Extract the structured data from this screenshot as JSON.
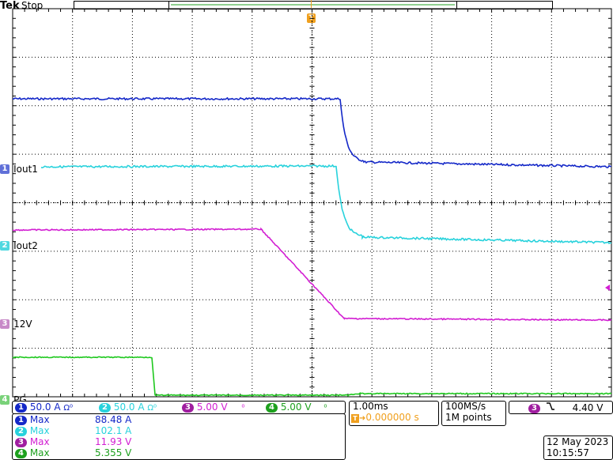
{
  "header": {
    "brand": "Tek",
    "status": "Stop",
    "trigger_marker": "T"
  },
  "colors": {
    "ch1": "#1428c8",
    "ch2": "#28d2dc",
    "ch3": "#d21ed2",
    "ch4": "#1ec81e",
    "trigger": "#f0a01e",
    "grid": "#000000"
  },
  "channel_markers": [
    {
      "num": "1",
      "label": "Iout1"
    },
    {
      "num": "2",
      "label": "Iout2"
    },
    {
      "num": "3",
      "label": "12V"
    },
    {
      "num": "4",
      "label": "PG"
    }
  ],
  "channel_settings": [
    {
      "num": "1",
      "scale": "50.0 A",
      "coupling": "Ω⁰"
    },
    {
      "num": "2",
      "scale": "50.0 A",
      "coupling": "Ω⁰"
    },
    {
      "num": "3",
      "scale": "5.00 V",
      "coupling": "⁰"
    },
    {
      "num": "4",
      "scale": "5.00 V",
      "coupling": "⁰"
    }
  ],
  "measurements": [
    {
      "num": "1",
      "type": "Max",
      "value": "88.48 A"
    },
    {
      "num": "2",
      "type": "Max",
      "value": "102.1 A"
    },
    {
      "num": "3",
      "type": "Max",
      "value": "11.93 V"
    },
    {
      "num": "4",
      "type": "Max",
      "value": "5.355 V"
    }
  ],
  "timebase": {
    "time_per_div": "1.00ms",
    "trigger_position": "0.000000 s",
    "sample_rate": "100MS/s",
    "record_length": "1M points"
  },
  "trigger": {
    "source": "3",
    "slope_icon": "falling-edge-icon",
    "level": "4.40 V"
  },
  "datetime": {
    "date": "12 May 2023",
    "time": "10:15:57"
  }
}
